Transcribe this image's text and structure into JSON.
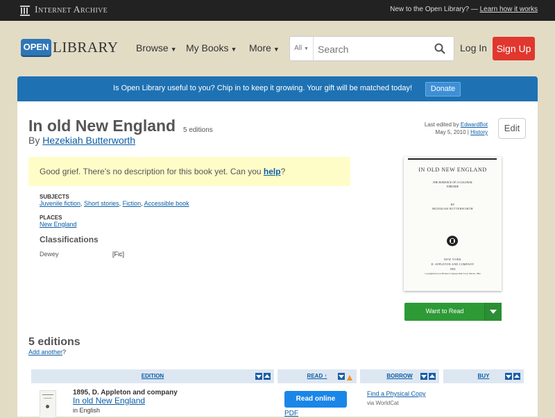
{
  "ia_bar": {
    "logo_text": "Internet Archive",
    "notice": "New to the Open Library? —",
    "learn_link": "Learn how it works"
  },
  "header": {
    "logo_open": "OPEN",
    "logo_library": "LIBRARY",
    "nav": [
      {
        "label": "Browse"
      },
      {
        "label": "My Books"
      },
      {
        "label": "More"
      }
    ],
    "search_scope": "All",
    "search_placeholder": "Search",
    "login": "Log In",
    "signup": "Sign Up"
  },
  "banner": {
    "text": "Is Open Library useful to you? Chip in to keep it growing. Your gift will be matched today!",
    "donate": "Donate"
  },
  "work": {
    "title": "In old New England",
    "edition_count": "5 editions",
    "by": "By",
    "author": "Hezekiah Butterworth",
    "last_edited_label": "Last edited by",
    "last_edited_by": "EdwardBot",
    "edit_date": "May 5, 2010",
    "history": "History",
    "edit_button": "Edit",
    "description_text": "Good grief. There's no description for this book yet. Can you",
    "description_link": "help",
    "description_end": "?",
    "subjects_heading": "SUBJECTS",
    "subjects": [
      "Juvenile fiction",
      "Short stories",
      "Fiction",
      "Accessible book"
    ],
    "places_heading": "PLACES",
    "places": [
      "New England"
    ],
    "classifications_heading": "Classifications",
    "dewey_label": "Dewey",
    "dewey_value": "[Fic]",
    "want_to_read": "Want to Read"
  },
  "cover": {
    "title": "IN OLD NEW ENGLAND",
    "subtitle": "THE ROMANCE OF A COLONIAL FIRESIDE",
    "by_line": "BY",
    "author": "HEZEKIAH BUTTERWORTH",
    "city": "NEW YORK",
    "publisher": "D. APPLETON AND COMPANY",
    "year": "1895",
    "copyright": "Copyrighted by Lee Brothers Company, Bath Town, Ontario, 1894"
  },
  "editions": {
    "heading": "5 editions",
    "add_another": "Add another",
    "add_another_end": "?",
    "columns": {
      "edition": "EDITION",
      "read": "READ ↑",
      "borrow": "BORROW",
      "buy": "BUY"
    },
    "rows": [
      {
        "publisher": "1895, D. Appleton and company",
        "title": "In old New England",
        "language": "in English",
        "read_button": "Read online",
        "format": "PDF",
        "find_copy": "Find a Physical Copy",
        "via": "via WorldCat"
      }
    ]
  }
}
